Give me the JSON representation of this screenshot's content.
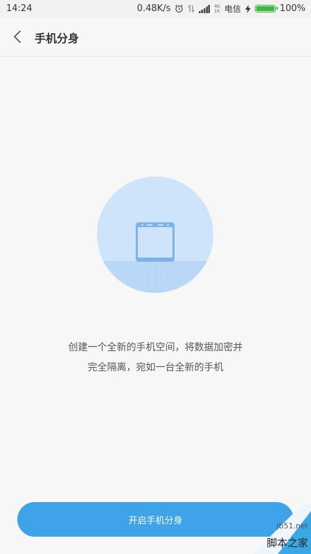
{
  "status_bar": {
    "time": "14:24",
    "net_speed": "0.48K/s",
    "lte_top": "4G",
    "lte_bottom": "1X",
    "carrier": "电信",
    "battery_percent": "100%",
    "battery_level": 1.0,
    "battery_color": "#3cb93c"
  },
  "header": {
    "back_icon": "chevron-left-icon",
    "title": "手机分身"
  },
  "illustration": {
    "icon": "phone-illustration-icon",
    "circle_color": "#cde4fb"
  },
  "description": {
    "line1": "创建一个全新的手机空间，将数据加密并",
    "line2": "完全隔离，宛如一台全新的手机"
  },
  "actions": {
    "start_label": "开启手机分身",
    "accent_color": "#3ea3e8"
  },
  "watermark": {
    "url": "jb51.net",
    "name": "脚本之家"
  }
}
